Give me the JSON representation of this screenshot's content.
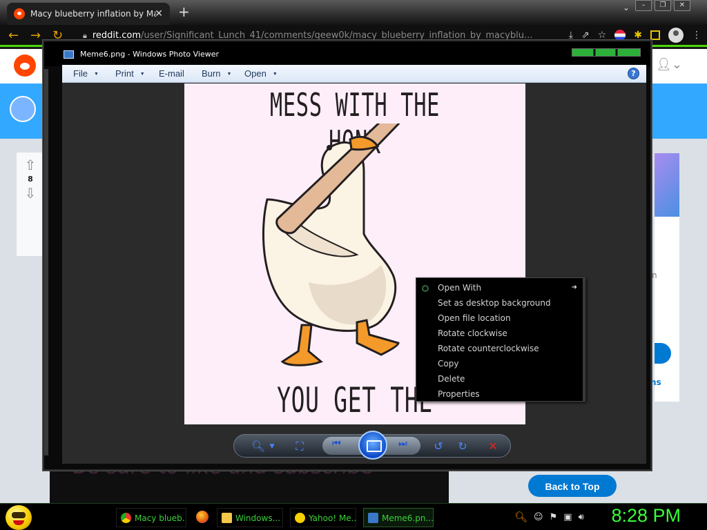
{
  "browser": {
    "tab_title": "Macy blueberry inflation by Mac",
    "tab_close": "✕",
    "new_tab": "+",
    "url_domain": "reddit.com",
    "url_path": "/user/Significant_Lunch_41/comments/qeew0k/macy_blueberry_inflation_by_macyblu..."
  },
  "reddit": {
    "vote_count": "8",
    "back_to_top": "Back to Top",
    "fragment_n": "n",
    "fragment_ns": "ns",
    "ghost_text": "Be sure to like and subscribe"
  },
  "viewer": {
    "title": "Meme6.png - Windows Photo Viewer",
    "menu": {
      "file": "File",
      "print": "Print",
      "email": "E-mail",
      "burn": "Burn",
      "open": "Open"
    },
    "help": "?"
  },
  "meme": {
    "top_text": "MESS WITH THE HONK",
    "bottom_text": "YOU GET THE BONK"
  },
  "context_menu": {
    "items": [
      "Open With",
      "Set as desktop background",
      "Open file location",
      "Rotate clockwise",
      "Rotate counterclockwise",
      "Copy",
      "Delete",
      "Properties"
    ]
  },
  "taskbar": {
    "items": [
      "Macy blueb...",
      "Windows...",
      "Yahoo! Me...",
      "Meme6.pn..."
    ],
    "clock": "8:28 PM"
  },
  "colors": {
    "reddit_orange": "#ff4500",
    "reddit_blue": "#0079d3",
    "taskbar_green": "#3ad23a",
    "meme_background": "#fdeefa"
  }
}
